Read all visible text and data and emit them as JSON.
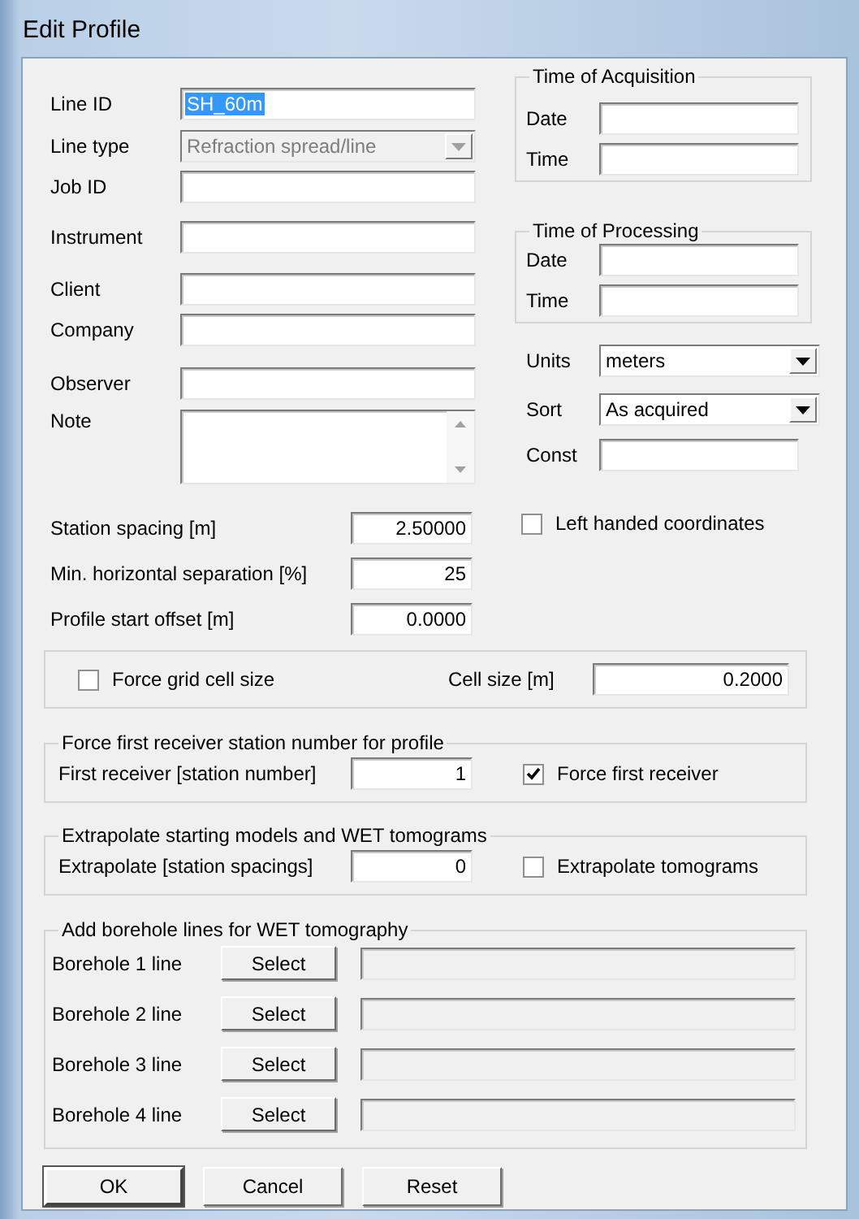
{
  "window": {
    "title": "Edit Profile"
  },
  "profile_fields": [
    {
      "label": "Line ID",
      "kind": "text",
      "value": "SH_60m",
      "text_selected": true
    },
    {
      "label": "Line type",
      "kind": "combo",
      "value": "Refraction spread/line",
      "disabled": true
    },
    {
      "label": "Job ID",
      "kind": "text"
    },
    {
      "label": "Instrument",
      "kind": "text"
    },
    {
      "label": "Client",
      "kind": "text"
    },
    {
      "label": "Company",
      "kind": "text"
    },
    {
      "label": "Observer",
      "kind": "text"
    },
    {
      "label": "Note",
      "kind": "memo"
    }
  ],
  "time_of_acquisition": {
    "title": "Time of Acquisition",
    "fields": [
      {
        "label": "Date"
      },
      {
        "label": "Time"
      }
    ]
  },
  "time_of_processing": {
    "title": "Time of Processing",
    "fields": [
      {
        "label": "Date"
      },
      {
        "label": "Time"
      }
    ]
  },
  "options": [
    {
      "label": "Units",
      "kind": "combo",
      "value": "meters",
      "disabled": false
    },
    {
      "label": "Sort",
      "kind": "combo",
      "value": "As acquired",
      "disabled": false
    },
    {
      "label": "Const",
      "kind": "text"
    }
  ],
  "left_handed_coordinates": {
    "label": "Left handed coordinates",
    "checked": false
  },
  "spacing_fields": [
    {
      "label": "Station spacing [m]",
      "value": "2.50000"
    },
    {
      "label": "Min. horizontal separation [%]",
      "value": "25"
    },
    {
      "label": "Profile start offset [m]",
      "value": "0.0000"
    }
  ],
  "grid_cell": {
    "checkbox": {
      "label": "Force grid cell size",
      "checked": false
    },
    "field": {
      "label": "Cell size [m]",
      "value": "0.2000"
    }
  },
  "first_receiver": {
    "title": "Force first receiver station number for profile",
    "field": {
      "label": "First receiver [station number]",
      "value": "1"
    },
    "checkbox": {
      "label": "Force first receiver",
      "checked": true
    }
  },
  "extrapolate": {
    "title": "Extrapolate starting models and WET tomograms",
    "field": {
      "label": "Extrapolate [station spacings]",
      "value": "0"
    },
    "checkbox": {
      "label": "Extrapolate tomograms",
      "checked": false
    }
  },
  "borehole_lines": {
    "title": "Add borehole lines for WET tomography",
    "rows": [
      {
        "label": "Borehole 1 line",
        "button": "Select",
        "disabled": true
      },
      {
        "label": "Borehole 2 line",
        "button": "Select",
        "disabled": true
      },
      {
        "label": "Borehole 3 line",
        "button": "Select",
        "disabled": true
      },
      {
        "label": "Borehole 4 line",
        "button": "Select",
        "disabled": true
      }
    ]
  },
  "buttons": [
    {
      "label": "OK",
      "default": true
    },
    {
      "label": "Cancel",
      "default": false
    },
    {
      "label": "Reset",
      "default": false
    }
  ]
}
